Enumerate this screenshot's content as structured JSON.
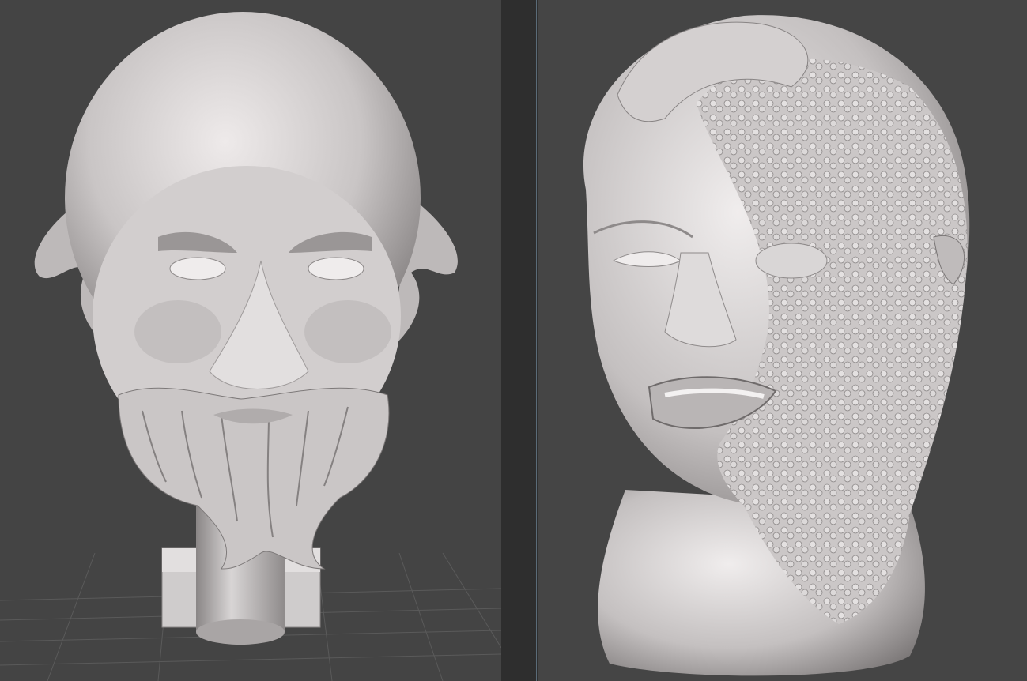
{
  "app": {
    "title": "",
    "views": [
      {
        "id": "left",
        "subject": "sculpted-bearded-old-man-head",
        "has_grid": true,
        "has_pedestal": true
      },
      {
        "id": "right",
        "subject": "sculpted-half-textured-face-bust",
        "has_grid": false,
        "has_pedestal": false
      }
    ]
  },
  "colors": {
    "background": "#444444",
    "grid_line": "#5a5a5a",
    "clay_light": "#e6e3e3",
    "clay_mid": "#b9b5b5",
    "clay_dark": "#6f6b6b",
    "splitter": "#2e2e2e",
    "splitter_edge": "#5a6b78"
  }
}
